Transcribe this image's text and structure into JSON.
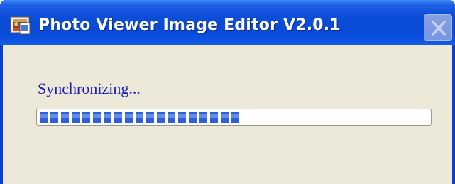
{
  "window": {
    "title": "Photo Viewer Image Editor V2.0.1"
  },
  "titlebar": {
    "icon": "app-icon",
    "close_icon": "close-icon",
    "close_enabled": false
  },
  "dialog": {
    "status_text": "Synchronizing...",
    "progress": {
      "percent": 52,
      "filled_blocks": 19
    }
  },
  "colors": {
    "titlebar": "#0a4ad6",
    "client_background": "#ece9d8",
    "status_text": "#1c1cb4",
    "progress_block": "#2f5fd6"
  }
}
